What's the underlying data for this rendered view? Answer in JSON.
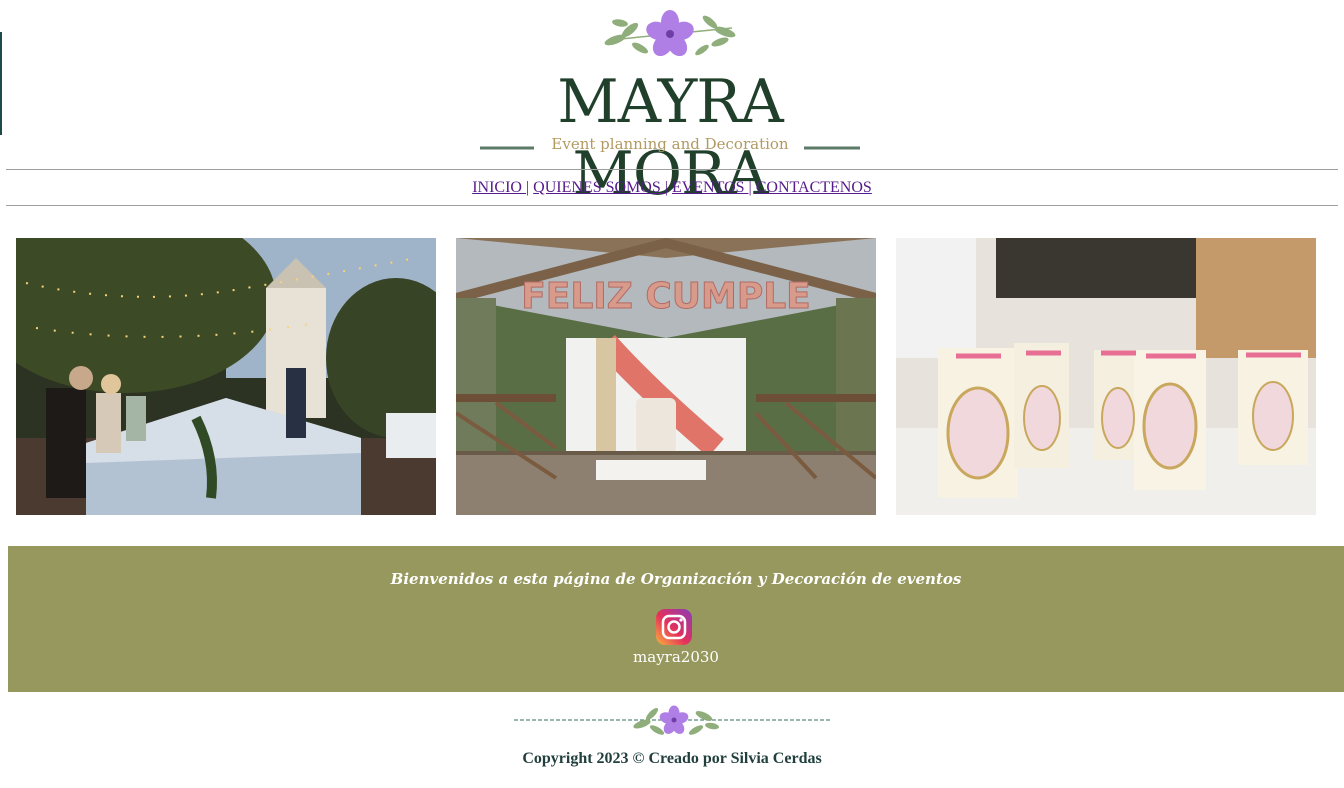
{
  "brand": {
    "name": "MAYRA MORA",
    "tagline": "Event planning and Decoration"
  },
  "nav": {
    "items": [
      {
        "label": "INICIO "
      },
      {
        "label": "QUIENES SOMOS "
      },
      {
        "label": "EVENTOS "
      },
      {
        "label": "CONTACTENOS"
      }
    ],
    "separator": "|"
  },
  "gallery": {
    "images": [
      {
        "name": "outdoor-dinner-photo"
      },
      {
        "name": "birthday-setup-photo"
      },
      {
        "name": "first-communion-favors-photo"
      }
    ]
  },
  "welcome": {
    "text": "Bienvenidos a esta página de Organización y Decoración de eventos",
    "instagram_handle": "mayra2030"
  },
  "footer": {
    "copyright": "Copyright 2023 © Creado por Silvia Cerdas"
  },
  "colors": {
    "brand_green": "#21402c",
    "tagline_gold": "#b39a63",
    "banner_olive": "#96985e",
    "link_purple": "#551a8b",
    "flower_purple": "#b07fe6"
  }
}
